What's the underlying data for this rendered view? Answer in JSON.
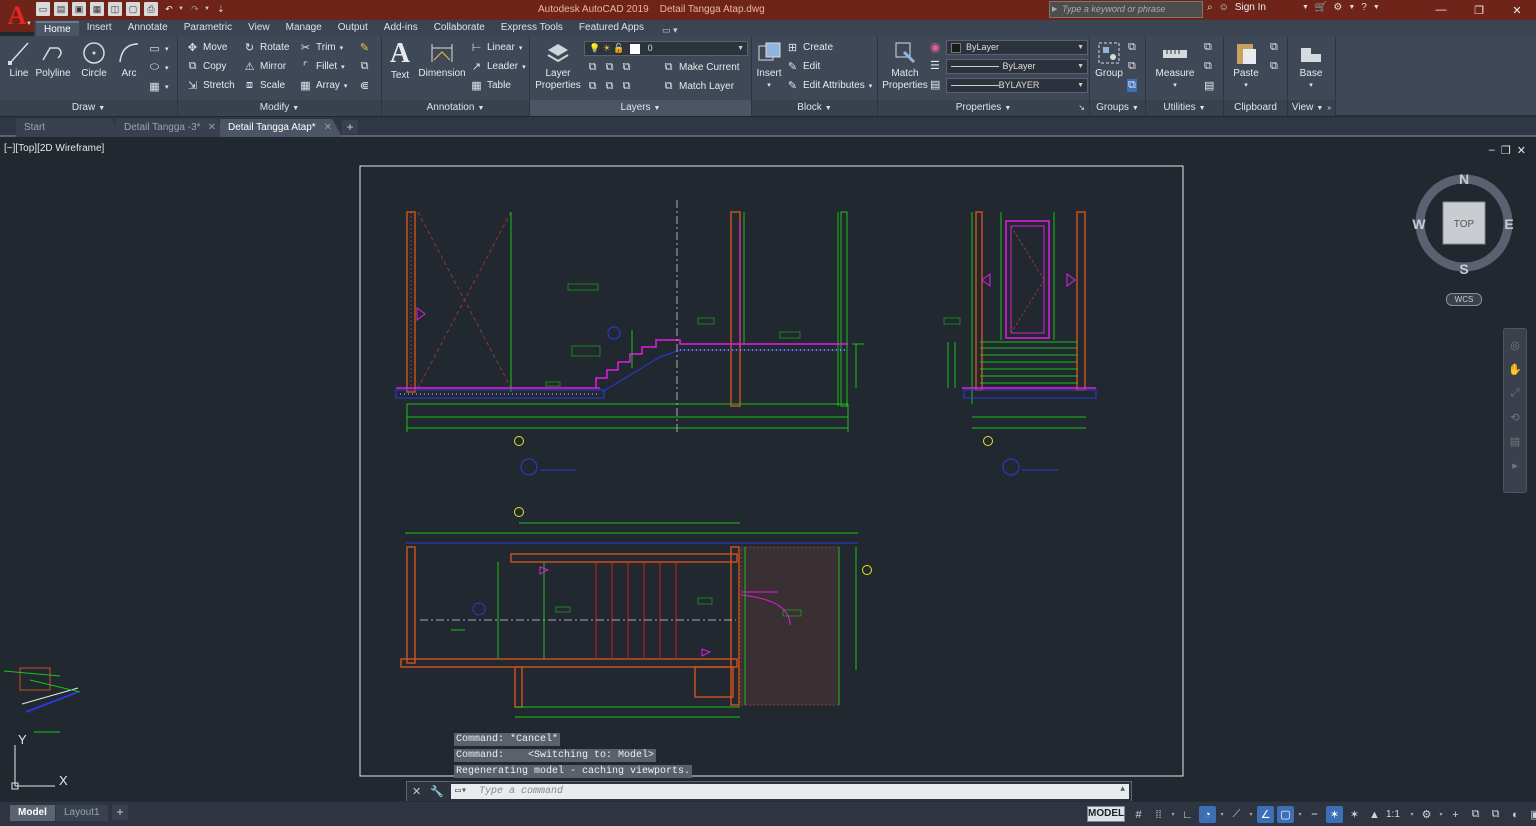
{
  "app": {
    "logo": "A",
    "title": "Autodesk AutoCAD 2019    Detail Tangga Atap.dwg"
  },
  "search": {
    "placeholder": "Type a keyword or phrase"
  },
  "account": {
    "sign_in": "Sign In"
  },
  "ribbon_tabs": [
    "Home",
    "Insert",
    "Annotate",
    "Parametric",
    "View",
    "Manage",
    "Output",
    "Add-ins",
    "Collaborate",
    "Express Tools",
    "Featured Apps"
  ],
  "draw": {
    "label": "Draw",
    "line": "Line",
    "polyline": "Polyline",
    "circle": "Circle",
    "arc": "Arc"
  },
  "modify": {
    "label": "Modify",
    "move": "Move",
    "rotate": "Rotate",
    "trim": "Trim",
    "copy": "Copy",
    "mirror": "Mirror",
    "fillet": "Fillet",
    "stretch": "Stretch",
    "scale": "Scale",
    "array": "Array"
  },
  "annotation": {
    "label": "Annotation",
    "text": "Text",
    "dimension": "Dimension",
    "linear": "Linear",
    "leader": "Leader",
    "table": "Table"
  },
  "layers": {
    "label": "Layers",
    "layer_properties": "Layer Properties",
    "current_layer": "0",
    "make_current": "Make Current",
    "match_layer": "Match Layer"
  },
  "block": {
    "label": "Block",
    "insert": "Insert",
    "create": "Create",
    "edit": "Edit",
    "edit_attributes": "Edit Attributes"
  },
  "properties": {
    "label": "Properties",
    "match_properties": "Match Properties",
    "color": "ByLayer",
    "linetype": "ByLayer",
    "lineweight": "BYLAYER",
    "color_swatch": "#1a1a1a"
  },
  "groups": {
    "label": "Groups",
    "group": "Group"
  },
  "utilities": {
    "label": "Utilities",
    "measure": "Measure"
  },
  "clipboard": {
    "label": "Clipboard",
    "paste": "Paste"
  },
  "view_panel": {
    "label": "View",
    "base": "Base"
  },
  "file_tabs": [
    {
      "label": "Start"
    },
    {
      "label": "Detail Tangga -3*"
    },
    {
      "label": "Detail Tangga Atap*"
    }
  ],
  "viewport": {
    "controls": "[−][Top][2D Wireframe]"
  },
  "viewcube": {
    "n": "N",
    "s": "S",
    "e": "E",
    "w": "W",
    "face": "TOP",
    "wcs": "WCS"
  },
  "ucs": {
    "y": "Y",
    "x": "X"
  },
  "command": {
    "history": [
      "Command: *Cancel*",
      "Command:    <Switching to: Model>",
      "Regenerating model - caching viewports."
    ],
    "placeholder": "Type a command"
  },
  "layout_tabs": [
    {
      "label": "Model"
    },
    {
      "label": "Layout1"
    }
  ],
  "status": {
    "model": "MODEL",
    "annotation_scale": "1:1"
  },
  "colors": {
    "background": "#212830",
    "ribbon": "#3f4857",
    "titlebar": "#6e2418",
    "wall": "#c8501f",
    "magenta": "#e01ee0",
    "green": "#19c219",
    "blue": "#2a3adf",
    "yellow": "#e6e61e"
  }
}
